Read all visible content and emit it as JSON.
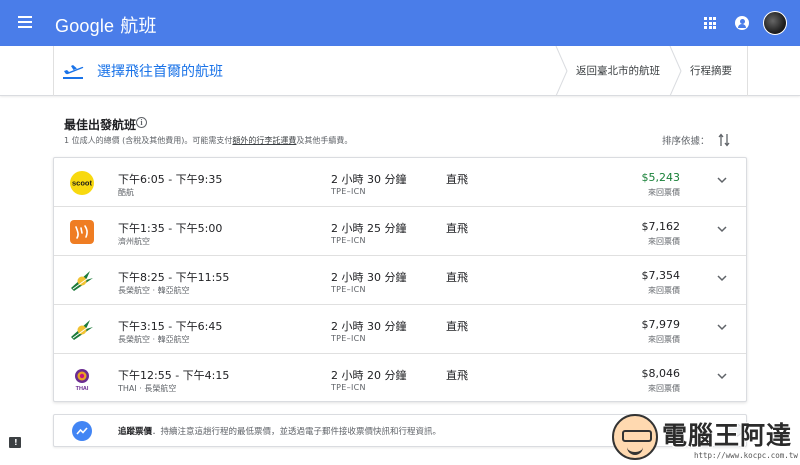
{
  "header": {
    "brand": "Google",
    "product": "航班",
    "icons": [
      "menu-icon",
      "apps-icon",
      "account-icon"
    ],
    "accent_color": "#4a7de9"
  },
  "breadcrumb": {
    "current": "選擇飛往首爾的航班",
    "steps": [
      "返回臺北市的航班",
      "行程摘要"
    ]
  },
  "results": {
    "title": "最佳出發航班",
    "note_prefix": "1 位成人的總價 (含稅及其他費用)。可能需支付",
    "note_link": "額外的行李託運費",
    "note_suffix": "及其他手續費。",
    "sort_label": "排序依據："
  },
  "flights": [
    {
      "times": "下午6:05 - 下午9:35",
      "airline": "酷航",
      "logo": "scoot-logo",
      "duration": "2 小時 30 分鐘",
      "route": "TPE–ICN",
      "stops": "直飛",
      "price": "$5,243",
      "fare_type": "來回票價",
      "cheapest": true
    },
    {
      "times": "下午1:35 - 下午5:00",
      "airline": "濟州航空",
      "logo": "jeju-air-logo",
      "duration": "2 小時 25 分鐘",
      "route": "TPE–ICN",
      "stops": "直飛",
      "price": "$7,162",
      "fare_type": "來回票價",
      "cheapest": false
    },
    {
      "times": "下午8:25 - 下午11:55",
      "airline": "長榮航空 · 韓亞航空",
      "logo": "eva-air-logo",
      "duration": "2 小時 30 分鐘",
      "route": "TPE–ICN",
      "stops": "直飛",
      "price": "$7,354",
      "fare_type": "來回票價",
      "cheapest": false
    },
    {
      "times": "下午3:15 - 下午6:45",
      "airline": "長榮航空 · 韓亞航空",
      "logo": "eva-air-logo",
      "duration": "2 小時 30 分鐘",
      "route": "TPE–ICN",
      "stops": "直飛",
      "price": "$7,979",
      "fare_type": "來回票價",
      "cheapest": false
    },
    {
      "times": "下午12:55 - 下午4:15",
      "airline": "THAI · 長榮航空",
      "logo": "thai-logo",
      "duration": "2 小時 20 分鐘",
      "route": "TPE–ICN",
      "stops": "直飛",
      "price": "$8,046",
      "fare_type": "來回票價",
      "cheapest": false
    }
  ],
  "tracking": {
    "title": "追蹤票價",
    "text": "．持續注意這趟行程的最低票價，並透過電子郵件接收票價快訊和行程資訊。"
  },
  "feedback_icon": "feedback-icon",
  "watermark": {
    "brand": "電腦王阿達",
    "url": "http://www.kocpc.com.tw"
  }
}
